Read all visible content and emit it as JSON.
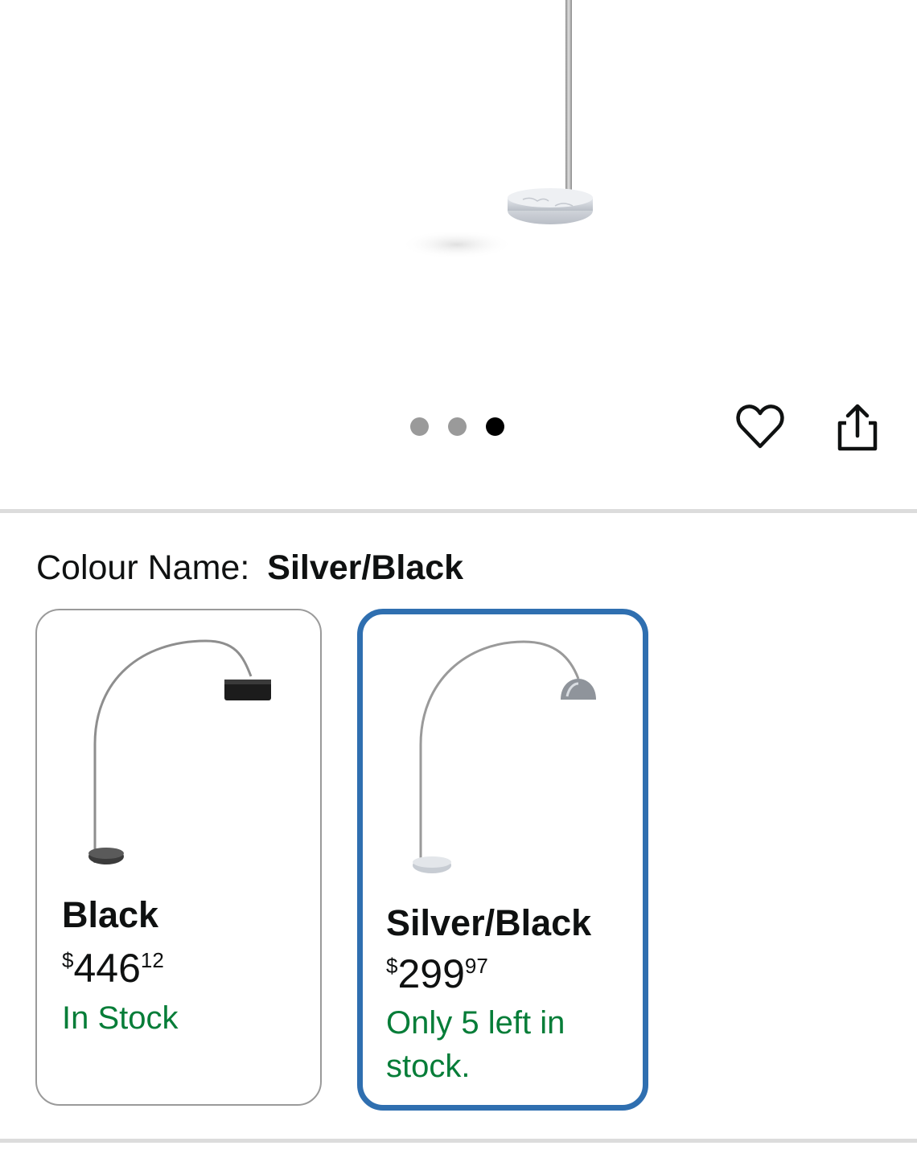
{
  "carousel": {
    "dot_count": 3,
    "active_index": 2
  },
  "actions": {
    "wishlist_icon": "heart-icon",
    "share_icon": "share-icon"
  },
  "colour": {
    "label": "Colour Name:",
    "selected": "Silver/Black"
  },
  "options": [
    {
      "name": "Black",
      "price_currency": "$",
      "price_whole": "446",
      "price_fraction": "12",
      "stock": "In Stock",
      "selected": false
    },
    {
      "name": "Silver/Black",
      "price_currency": "$",
      "price_whole": "299",
      "price_fraction": "97",
      "stock": "Only 5 left in stock.",
      "selected": true
    }
  ],
  "colors": {
    "selected_border": "#2f6fb0",
    "stock_green": "#067d38",
    "dot_inactive": "#9a9a9a",
    "dot_active": "#000000"
  }
}
